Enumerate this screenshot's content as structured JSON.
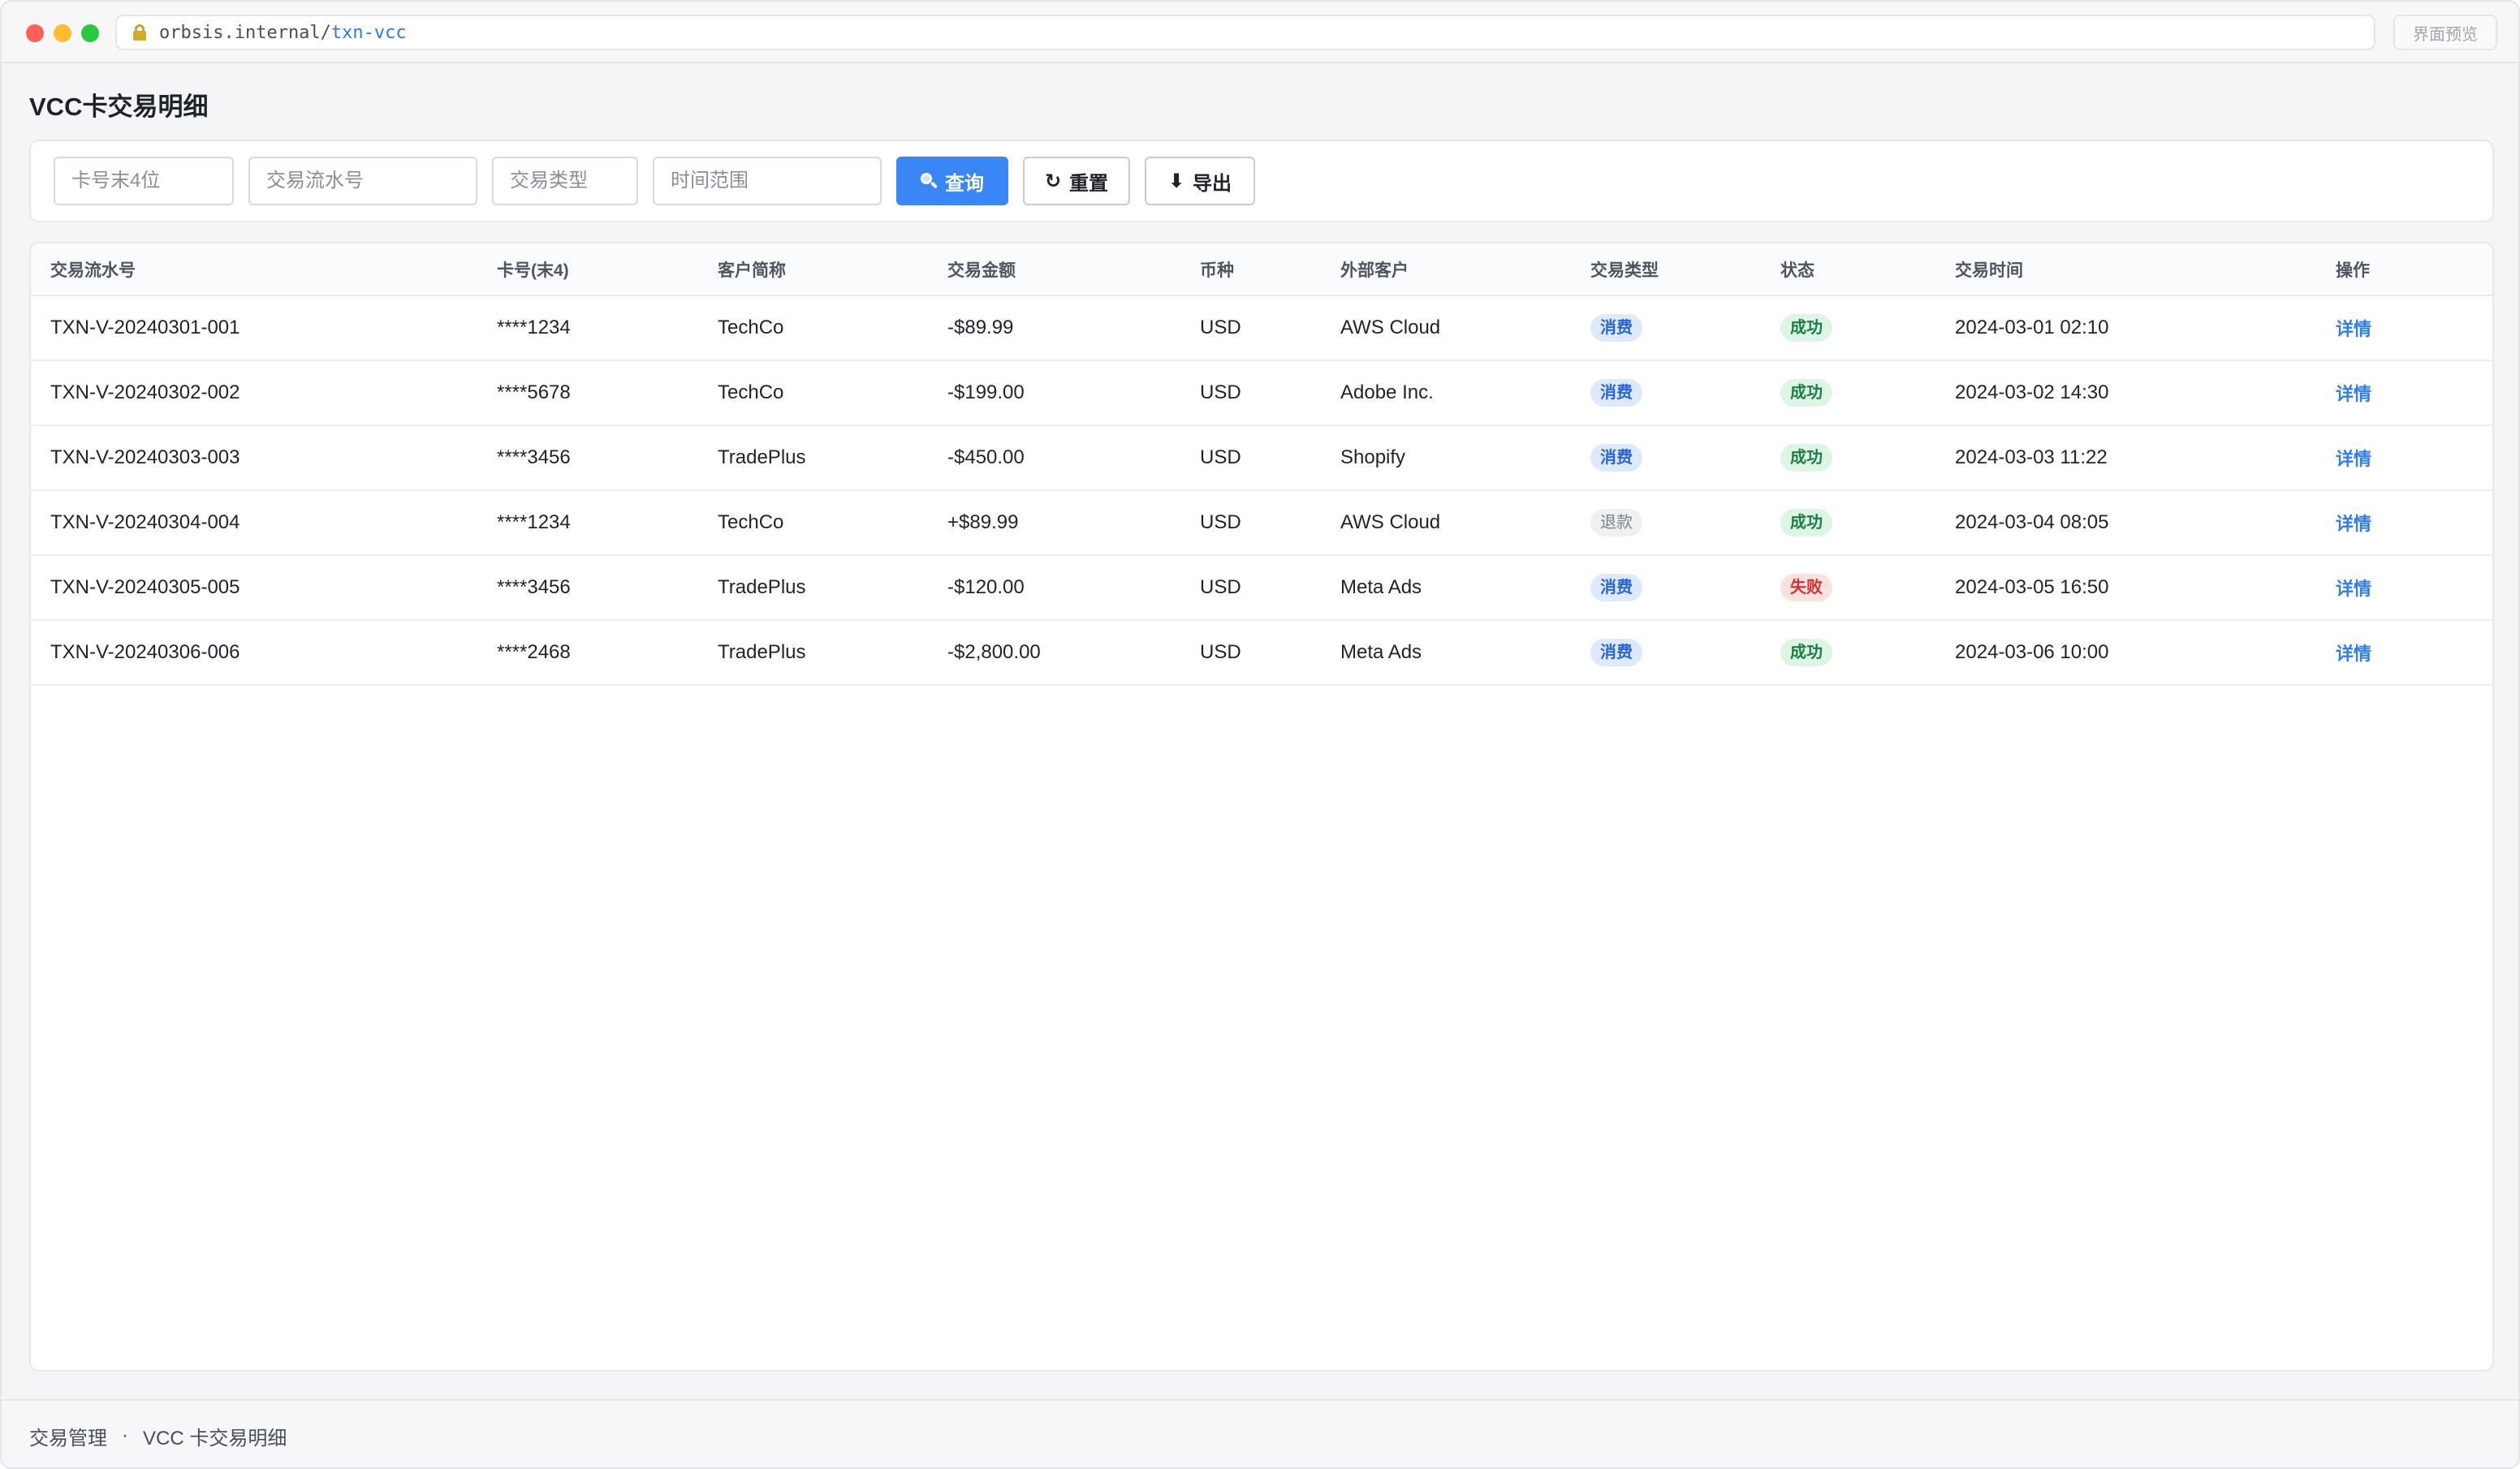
{
  "browser": {
    "url_host": "orbsis.internal/",
    "url_path": "txn-vcc",
    "preview_label": "界面预览"
  },
  "page": {
    "title": "VCC卡交易明细"
  },
  "filters": {
    "card_last4_placeholder": "卡号末4位",
    "txn_no_placeholder": "交易流水号",
    "txn_type_placeholder": "交易类型",
    "time_range_placeholder": "时间范围",
    "search_label": "查询",
    "reset_label": "重置",
    "export_label": "导出"
  },
  "table": {
    "headers": [
      "交易流水号",
      "卡号(末4)",
      "客户简称",
      "交易金额",
      "币种",
      "外部客户",
      "交易类型",
      "状态",
      "交易时间",
      "操作"
    ],
    "rows": [
      {
        "txn_no": "TXN-V-20240301-001",
        "card": "****1234",
        "customer": "TechCo",
        "amount": "-$89.99",
        "currency": "USD",
        "external": "AWS Cloud",
        "type": "消费",
        "type_style": "blue",
        "status": "成功",
        "status_style": "green",
        "time": "2024-03-01 02:10",
        "action": "详情"
      },
      {
        "txn_no": "TXN-V-20240302-002",
        "card": "****5678",
        "customer": "TechCo",
        "amount": "-$199.00",
        "currency": "USD",
        "external": "Adobe Inc.",
        "type": "消费",
        "type_style": "blue",
        "status": "成功",
        "status_style": "green",
        "time": "2024-03-02 14:30",
        "action": "详情"
      },
      {
        "txn_no": "TXN-V-20240303-003",
        "card": "****3456",
        "customer": "TradePlus",
        "amount": "-$450.00",
        "currency": "USD",
        "external": "Shopify",
        "type": "消费",
        "type_style": "blue",
        "status": "成功",
        "status_style": "green",
        "time": "2024-03-03 11:22",
        "action": "详情"
      },
      {
        "txn_no": "TXN-V-20240304-004",
        "card": "****1234",
        "customer": "TechCo",
        "amount": "+$89.99",
        "currency": "USD",
        "external": "AWS Cloud",
        "type": "退款",
        "type_style": "gray",
        "status": "成功",
        "status_style": "green",
        "time": "2024-03-04 08:05",
        "action": "详情"
      },
      {
        "txn_no": "TXN-V-20240305-005",
        "card": "****3456",
        "customer": "TradePlus",
        "amount": "-$120.00",
        "currency": "USD",
        "external": "Meta Ads",
        "type": "消费",
        "type_style": "blue",
        "status": "失败",
        "status_style": "red",
        "time": "2024-03-05 16:50",
        "action": "详情"
      },
      {
        "txn_no": "TXN-V-20240306-006",
        "card": "****2468",
        "customer": "TradePlus",
        "amount": "-$2,800.00",
        "currency": "USD",
        "external": "Meta Ads",
        "type": "消费",
        "type_style": "blue",
        "status": "成功",
        "status_style": "green",
        "time": "2024-03-06 10:00",
        "action": "详情"
      }
    ]
  },
  "footer": {
    "crumb_parent": "交易管理",
    "separator": "·",
    "crumb_current": "VCC 卡交易明细"
  }
}
